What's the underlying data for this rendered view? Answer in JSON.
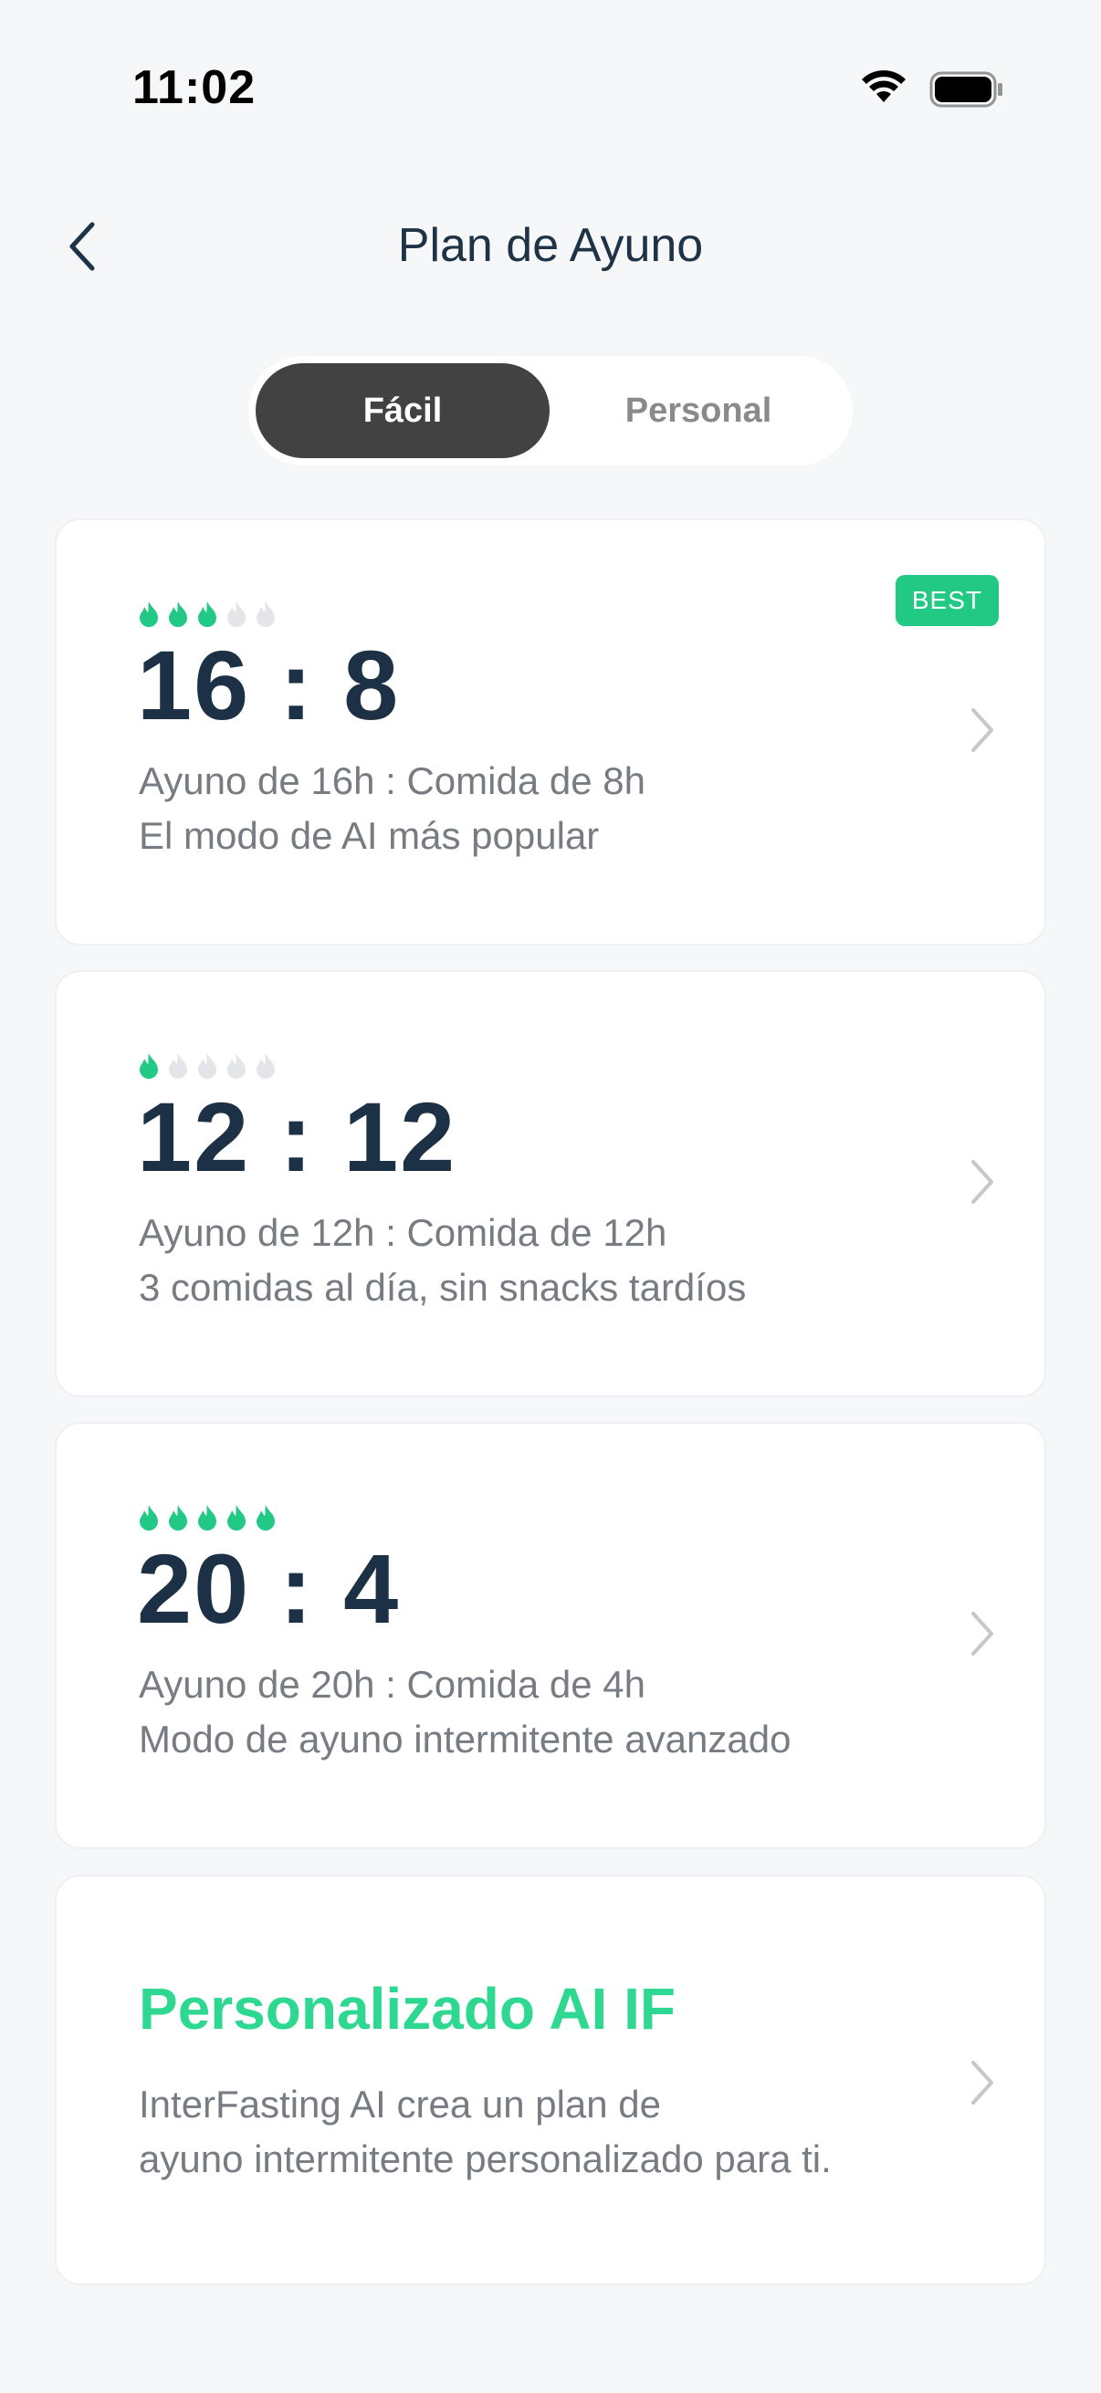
{
  "status": {
    "time": "11:02"
  },
  "nav": {
    "title": "Plan de Ayuno"
  },
  "tabs": [
    {
      "label": "Fácil",
      "active": true
    },
    {
      "label": "Personal",
      "active": false
    }
  ],
  "plans": [
    {
      "ratio": "16 : 8",
      "difficulty": 3,
      "max_difficulty": 5,
      "badge": "BEST",
      "line1": "Ayuno de 16h : Comida de 8h",
      "line2": "El modo de AI más popular"
    },
    {
      "ratio": "12 : 12",
      "difficulty": 1,
      "max_difficulty": 5,
      "line1": "Ayuno de 12h : Comida de 12h",
      "line2": "3 comidas al día, sin snacks tardíos"
    },
    {
      "ratio": "20 : 4",
      "difficulty": 5,
      "max_difficulty": 5,
      "line1": "Ayuno de 20h : Comida de 4h",
      "line2": "Modo de ayuno intermitente avanzado"
    }
  ],
  "custom": {
    "title": "Personalizado AI IF",
    "line1": "InterFasting AI crea un plan de",
    "line2": "ayuno intermitente personalizado para ti."
  },
  "colors": {
    "accent": "#22c985",
    "flame_on": "#22c985",
    "flame_off": "#e3e5e8",
    "tab_active_bg": "#424242"
  },
  "icons": {
    "back": "chevron-left-icon",
    "row": "chevron-right-icon",
    "difficulty": "flame-icon"
  }
}
